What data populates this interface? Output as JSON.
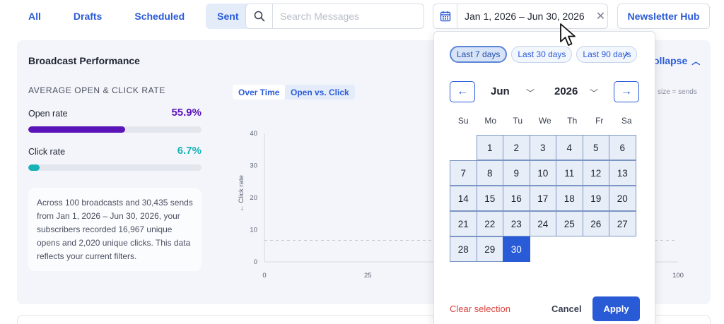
{
  "tabs": [
    {
      "label": "All",
      "active": false
    },
    {
      "label": "Drafts",
      "active": false
    },
    {
      "label": "Scheduled",
      "active": false
    },
    {
      "label": "Sent",
      "active": true
    }
  ],
  "search": {
    "placeholder": "Search Messages",
    "value": "",
    "icon": "search-icon"
  },
  "date_range": {
    "value": "Jan 1, 2026 – Jun 30, 2026",
    "icon": "calendar-icon",
    "clear_icon": "close-icon"
  },
  "hub_button": {
    "label": "Newsletter Hub"
  },
  "card": {
    "title": "Broadcast Performance",
    "collapse_label": "Collapse",
    "collapse_visible_text": "ollapse",
    "size_note": "size = sends",
    "metrics_heading": "AVERAGE OPEN & CLICK RATE",
    "open_rate": {
      "label": "Open rate",
      "value": "55.9%",
      "fraction": 0.559,
      "color": "#5a14b8"
    },
    "click_rate": {
      "label": "Click rate",
      "value": "6.7%",
      "fraction": 0.067,
      "color": "#17b3b7"
    },
    "summary": "Across 100 broadcasts and 30,435 sends from Jan 1, 2026 – Jun 30, 2026, your subscribers recorded 16,967 unique opens and 2,020 unique clicks. This data reflects your current filters.",
    "view_toggles": [
      {
        "label": "Over Time",
        "active": false
      },
      {
        "label": "Open vs. Click",
        "active": true
      }
    ]
  },
  "chart_data": {
    "type": "scatter",
    "ylabel": "← Click rate",
    "xlabel": "",
    "y_ticks": [
      "0",
      "10",
      "20",
      "30",
      "40"
    ],
    "x_ticks": [
      "0",
      "25",
      "100"
    ],
    "xlim": [
      0,
      100
    ],
    "ylim": [
      0,
      40
    ],
    "reference_line_y": 6.7,
    "series": []
  },
  "date_picker": {
    "presets": [
      {
        "label": "Last 7 days",
        "active": true
      },
      {
        "label": "Last 30 days",
        "active": false
      },
      {
        "label": "Last 90 days",
        "active": false
      }
    ],
    "presets_more_icon": "chevron-right-icon",
    "prev_icon": "arrow-left-icon",
    "next_icon": "arrow-right-icon",
    "prev_glyph": "←",
    "next_glyph": "→",
    "month": "Jun",
    "year": "2026",
    "weekdays": [
      "Su",
      "Mo",
      "Tu",
      "We",
      "Th",
      "Fr",
      "Sa"
    ],
    "weeks": [
      [
        "",
        "1",
        "2",
        "3",
        "4",
        "5",
        "6"
      ],
      [
        "7",
        "8",
        "9",
        "10",
        "11",
        "12",
        "13"
      ],
      [
        "14",
        "15",
        "16",
        "17",
        "18",
        "19",
        "20"
      ],
      [
        "21",
        "22",
        "23",
        "24",
        "25",
        "26",
        "27"
      ],
      [
        "28",
        "29",
        "30",
        "",
        "",
        "",
        ""
      ]
    ],
    "selected_day": "30",
    "clear_label": "Clear selection",
    "cancel_label": "Cancel",
    "apply_label": "Apply"
  },
  "colors": {
    "accent": "#2a5bd7",
    "danger": "#d9453f",
    "card_bg": "#f3f5fa"
  }
}
